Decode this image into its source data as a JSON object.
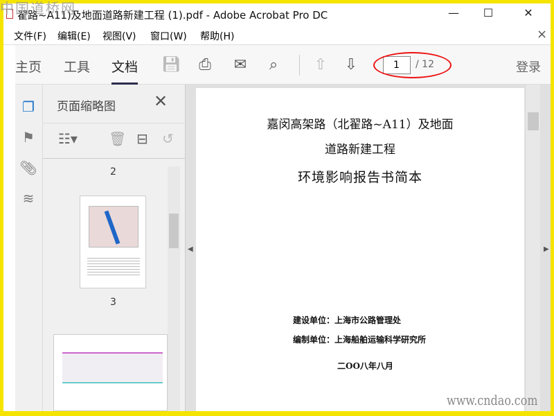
{
  "watermark_top": "中国道桥网",
  "window": {
    "title": "翟路~A11)及地面道路新建工程 (1).pdf - Adobe Acrobat Pro DC",
    "minimize": "—",
    "maximize": "☐",
    "close": "✕"
  },
  "menu": [
    "文件(F)",
    "编辑(E)",
    "视图(V)",
    "窗口(W)",
    "帮助(H)"
  ],
  "menu_close": "×",
  "tabs": {
    "home": "主页",
    "tools": "工具",
    "document": "文档"
  },
  "page_nav": {
    "current": "1",
    "total": "/ 12"
  },
  "login": "登录",
  "panel": {
    "title": "页面缩略图",
    "page_labels": [
      "2",
      "3"
    ]
  },
  "document": {
    "title_line1": "嘉闵高架路（北翟路~A11）及地面",
    "title_line2": "道路新建工程",
    "title_line3": "环境影响报告书简本",
    "builder": "建设单位：上海市公路管理处",
    "compiler": "编制单位：上海船舶运输科学研究所",
    "date": "二OO八年八月"
  },
  "watermark_bottom": "www.cndao.com"
}
